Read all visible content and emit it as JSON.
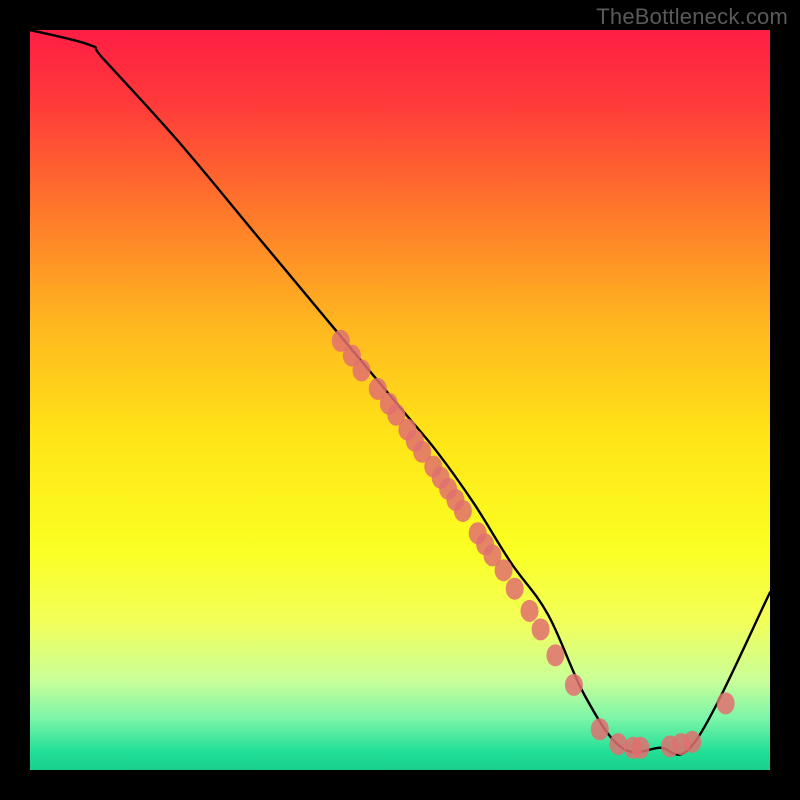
{
  "watermark": "TheBottleneck.com",
  "chart_data": {
    "type": "line",
    "title": "",
    "xlabel": "",
    "ylabel": "",
    "xlim": [
      0,
      100
    ],
    "ylim": [
      0,
      100
    ],
    "grid": false,
    "line": {
      "x": [
        0,
        8,
        10,
        20,
        30,
        40,
        50,
        55,
        60,
        65,
        70,
        75,
        80,
        85,
        90,
        100
      ],
      "y": [
        100,
        98,
        96,
        85,
        73,
        61,
        49,
        43,
        36,
        28,
        21,
        10,
        3,
        3,
        4,
        24
      ]
    },
    "markers": [
      {
        "x": 42.0,
        "y": 58.0
      },
      {
        "x": 43.5,
        "y": 56.0
      },
      {
        "x": 44.8,
        "y": 54.0
      },
      {
        "x": 47.0,
        "y": 51.5
      },
      {
        "x": 48.5,
        "y": 49.5
      },
      {
        "x": 49.5,
        "y": 48.0
      },
      {
        "x": 51.0,
        "y": 46.0
      },
      {
        "x": 52.0,
        "y": 44.5
      },
      {
        "x": 53.0,
        "y": 43.0
      },
      {
        "x": 54.5,
        "y": 41.0
      },
      {
        "x": 55.5,
        "y": 39.5
      },
      {
        "x": 56.5,
        "y": 38.0
      },
      {
        "x": 57.5,
        "y": 36.5
      },
      {
        "x": 58.5,
        "y": 35.0
      },
      {
        "x": 60.5,
        "y": 32.0
      },
      {
        "x": 61.5,
        "y": 30.5
      },
      {
        "x": 62.5,
        "y": 29.0
      },
      {
        "x": 64.0,
        "y": 27.0
      },
      {
        "x": 65.5,
        "y": 24.5
      },
      {
        "x": 67.5,
        "y": 21.5
      },
      {
        "x": 69.0,
        "y": 19.0
      },
      {
        "x": 71.0,
        "y": 15.5
      },
      {
        "x": 73.5,
        "y": 11.5
      },
      {
        "x": 77.0,
        "y": 5.5
      },
      {
        "x": 79.5,
        "y": 3.5
      },
      {
        "x": 81.5,
        "y": 3.0
      },
      {
        "x": 82.5,
        "y": 3.0
      },
      {
        "x": 86.5,
        "y": 3.2
      },
      {
        "x": 88.0,
        "y": 3.5
      },
      {
        "x": 89.5,
        "y": 3.8
      },
      {
        "x": 94.0,
        "y": 9.0
      }
    ],
    "marker_style": {
      "fill": "#E07070",
      "radius_x": 9,
      "radius_y": 11,
      "opacity": 0.85
    },
    "line_style": {
      "stroke": "#000000",
      "width": 2.4
    },
    "gradient_stops": [
      {
        "offset": 0.0,
        "color": "#FF1E44"
      },
      {
        "offset": 0.1,
        "color": "#FF3A3A"
      },
      {
        "offset": 0.25,
        "color": "#FF7A2A"
      },
      {
        "offset": 0.4,
        "color": "#FFB81F"
      },
      {
        "offset": 0.55,
        "color": "#FFE417"
      },
      {
        "offset": 0.7,
        "color": "#FBFF22"
      },
      {
        "offset": 0.8,
        "color": "#F2FF5A"
      },
      {
        "offset": 0.88,
        "color": "#C8FF9A"
      },
      {
        "offset": 0.93,
        "color": "#7CF5A8"
      },
      {
        "offset": 0.975,
        "color": "#22E097"
      },
      {
        "offset": 1.0,
        "color": "#18CF8C"
      }
    ]
  }
}
